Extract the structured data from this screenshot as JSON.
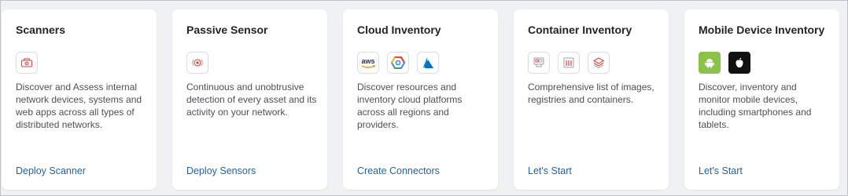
{
  "cards": [
    {
      "title": "Scanners",
      "icons": [
        "scanner-device-icon"
      ],
      "description": "Discover and Assess internal network devices, systems and web apps across all types of distributed networks.",
      "link": "Deploy Scanner"
    },
    {
      "title": "Passive Sensor",
      "icons": [
        "passive-sensor-icon"
      ],
      "description": "Continuous and unobtrusive detection of every asset and its activity on your network.",
      "link": "Deploy Sensors"
    },
    {
      "title": "Cloud Inventory",
      "icons": [
        "aws-icon",
        "google-cloud-icon",
        "azure-icon"
      ],
      "aws_label": "aws",
      "description": "Discover resources and inventory cloud platforms across all regions and providers.",
      "link": "Create Connectors"
    },
    {
      "title": "Container Inventory",
      "icons": [
        "container-image-icon",
        "container-registry-icon",
        "layers-icon"
      ],
      "description": "Comprehensive list of images, registries and containers.",
      "link": "Let's Start"
    },
    {
      "title": "Mobile Device Inventory",
      "icons": [
        "android-icon",
        "apple-icon"
      ],
      "description": "Discover, inventory and monitor mobile devices, including smartphones and tablets.",
      "link": "Let's Start"
    }
  ],
  "colors": {
    "link": "#1b64a8",
    "accent_red": "#d8403a",
    "android_green": "#8bc34a",
    "azure_blue": "#0078d4"
  }
}
